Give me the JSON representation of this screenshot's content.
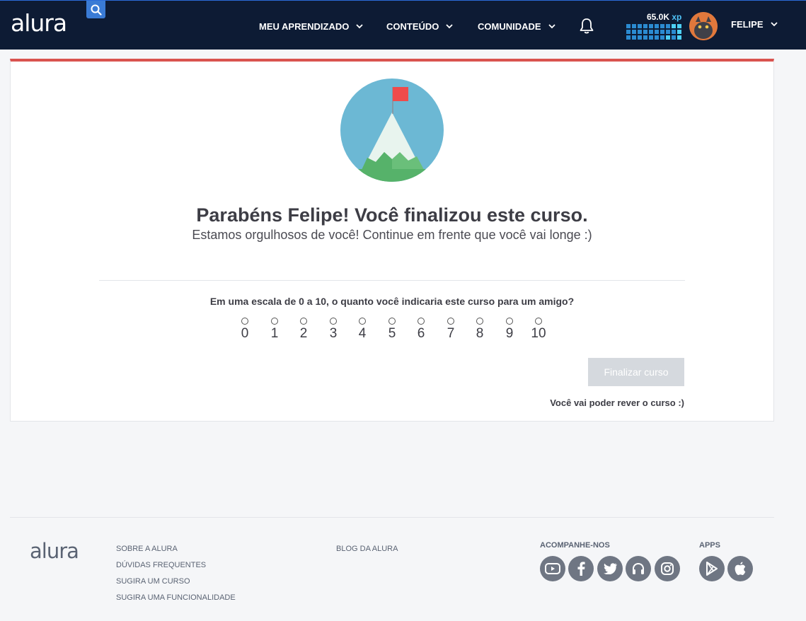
{
  "header": {
    "logo_text": "alura",
    "nav": [
      {
        "label": "MEU APRENDIZADO"
      },
      {
        "label": "CONTEÚDO"
      },
      {
        "label": "COMUNIDADE"
      }
    ],
    "xp_value": "65.0K",
    "xp_unit": "xp",
    "user_name": "FELIPE"
  },
  "main": {
    "title": "Parabéns Felipe! Você finalizou este curso.",
    "subtitle": "Estamos orgulhosos de você! Continue em frente que você vai longe :)",
    "question": "Em uma escala de 0 a 10, o quanto você indicaria este curso para um amigo?",
    "scale": [
      "0",
      "1",
      "2",
      "3",
      "4",
      "5",
      "6",
      "7",
      "8",
      "9",
      "10"
    ],
    "finish_button": "Finalizar curso",
    "review_note": "Você vai poder rever o curso :)"
  },
  "footer": {
    "logo_text": "alura",
    "links_col1": [
      "SOBRE A ALURA",
      "DÚVIDAS FREQUENTES",
      "SUGIRA UM CURSO",
      "SUGIRA UMA FUNCIONALIDADE"
    ],
    "links_col2": [
      "BLOG DA ALURA"
    ],
    "social_heading": "ACOMPANHE-NOS",
    "social_icons": [
      "youtube-icon",
      "facebook-icon",
      "twitter-icon",
      "podcast-icon",
      "instagram-icon"
    ],
    "apps_heading": "APPS",
    "app_icons": [
      "google-play-icon",
      "apple-icon"
    ]
  },
  "colors": {
    "header_bg": "#0d1b34",
    "accent_red": "#d9534f",
    "xp_blue": "#2b8bd1",
    "button_disabled": "#d5d9de"
  }
}
